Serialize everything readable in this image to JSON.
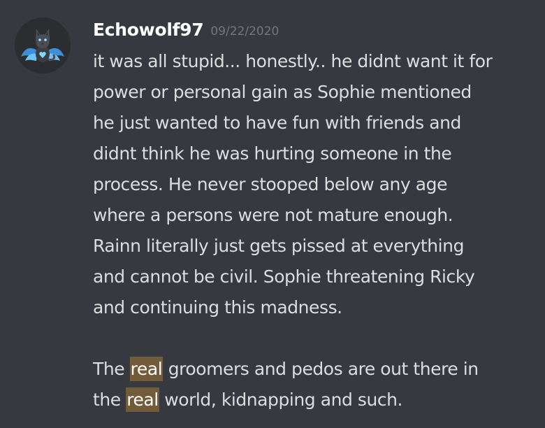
{
  "message": {
    "username": "Echowolf97",
    "timestamp": "09/22/2020",
    "avatar_icon": "wolf-avatar-icon",
    "paragraph1_lines": [
      "it was all stupid... honestly.. he didnt want it for",
      "power or personal gain as Sophie mentioned",
      "he just wanted to have fun with friends and",
      "didnt think he was hurting someone in the",
      "process. He never stooped below any age",
      "where a persons were not mature enough.",
      "Rainn literally just gets pissed at everything",
      "and cannot be civil. Sophie threatening Ricky",
      "and continuing this madness."
    ],
    "paragraph2": {
      "line1_before": "The ",
      "line1_highlight": "real",
      "line1_after": " groomers and pedos are out there in",
      "line2_before": "the ",
      "line2_highlight": "real",
      "line2_after": " world, kidnapping and such."
    }
  },
  "colors": {
    "background": "#36393f",
    "username": "#ffffff",
    "timestamp": "#72767d",
    "text": "#dcddde",
    "highlight": "#715b3a"
  }
}
